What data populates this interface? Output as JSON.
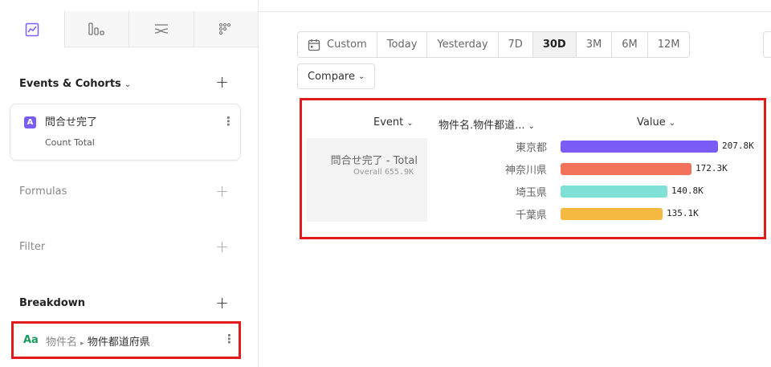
{
  "sidebar": {
    "tabs": [
      {
        "name": "insights-chart-icon"
      },
      {
        "name": "funnels-icon"
      },
      {
        "name": "flows-icon"
      },
      {
        "name": "retention-icon"
      }
    ],
    "events_title": "Events & Cohorts",
    "event": {
      "badge": "A",
      "name": "問合せ完了",
      "measure": "Count Total"
    },
    "formulas_title": "Formulas",
    "filter_title": "Filter",
    "breakdown_title": "Breakdown",
    "breakdown": {
      "type_label": "Aa",
      "parent": "物件名",
      "property": "物件都道府県"
    }
  },
  "date_range": {
    "segments": [
      "Custom",
      "Today",
      "Yesterday",
      "7D",
      "30D",
      "3M",
      "6M",
      "12M"
    ],
    "active": "30D"
  },
  "compare_label": "Compare",
  "table": {
    "headers": {
      "event": "Event",
      "breakdown": "物件名.物件都道...",
      "value": "Value"
    },
    "event_name": "問合せ完了 - Total",
    "overall_label": "Overall",
    "overall_value": "655.9K",
    "bar_max": 207800
  },
  "chart_data": {
    "type": "bar",
    "categories": [
      "東京都",
      "神奈川県",
      "埼玉県",
      "千葉県"
    ],
    "values": [
      207800,
      172300,
      140800,
      135100
    ],
    "labels": [
      "207.8K",
      "172.3K",
      "140.8K",
      "135.1K"
    ],
    "colors": [
      "#7b5cf5",
      "#f2735a",
      "#7fe0d5",
      "#f5b840"
    ]
  }
}
